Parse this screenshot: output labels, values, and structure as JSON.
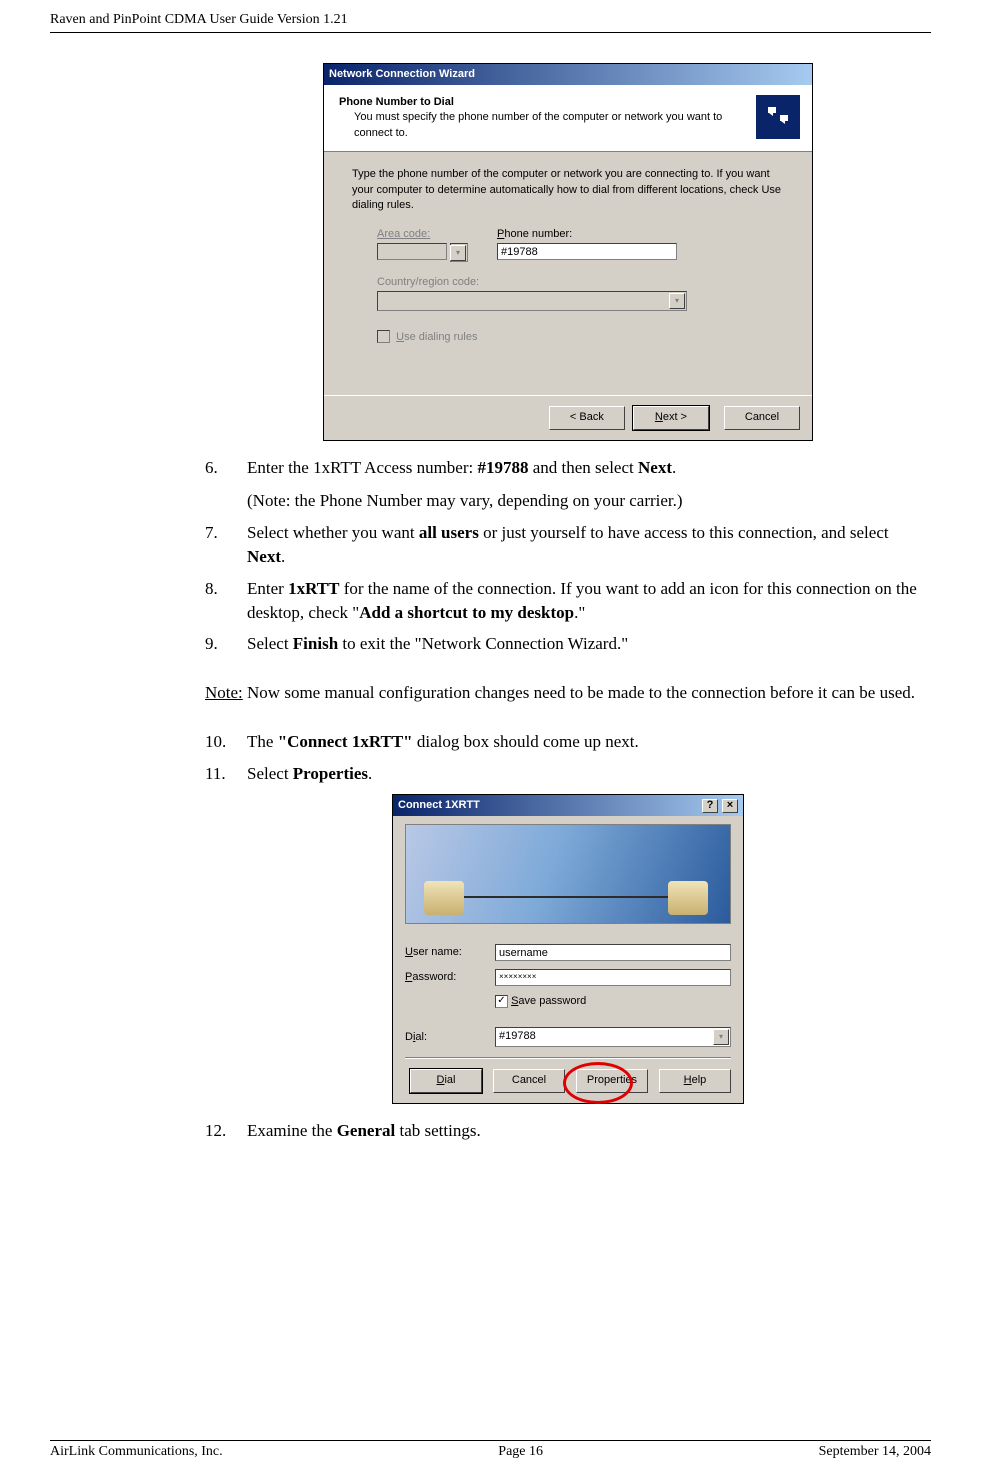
{
  "header": "Raven and PinPoint CDMA User Guide Version 1.21",
  "steps": {
    "s6_num": "6.",
    "s6": "Enter the 1xRTT Access number: ",
    "s6_b": "#19788",
    "s6_after": " and then select ",
    "s6_b2": "Next",
    "s6_end": ".",
    "s6_note": "(Note: the Phone Number may vary, depending on your carrier.)",
    "s7_num": "7.",
    "s7": "Select whether you want ",
    "s7_b": "all users",
    "s7_after": " or just yourself to have access to this connection, and select ",
    "s7_b2": "Next",
    "s7_end": ".",
    "s8_num": "8.",
    "s8": "Enter ",
    "s8_b": "1xRTT",
    "s8_after": " for the name of the connection. If you want to add an icon for this connection on the desktop, check \"",
    "s8_b2": "Add a shortcut to my desktop",
    "s8_end": ".\"",
    "s9_num": "9.",
    "s9": "Select ",
    "s9_b": "Finish",
    "s9_after": " to exit the \"Network Connection Wizard.\"",
    "note_lbl": "Note:",
    "note_txt": " Now some manual configuration changes need to be made to the connection before it can be used.",
    "s10_num": "10.",
    "s10": "The ",
    "s10_b": "\"Connect 1xRTT\"",
    "s10_after": " dialog box should come up next.",
    "s11_num": "11.",
    "s11": "Select ",
    "s11_b": "Properties",
    "s11_end": ".",
    "s12_num": "12.",
    "s12": "Examine the ",
    "s12_b": "General",
    "s12_after": " tab settings."
  },
  "dlg1": {
    "title": "Network Connection Wizard",
    "heading": "Phone Number to Dial",
    "sub": "You must specify the phone number of the computer or network you want to connect to.",
    "instr": "Type the phone number of the computer or network you are connecting to. If you want your computer to determine automatically how to dial from different locations, check Use dialing rules.",
    "lbl_area": "Area code:",
    "lbl_phone": "Phone number:",
    "phone_val": "#19788",
    "lbl_country": "Country/region code:",
    "chk_rules": "Use dialing rules",
    "btn_back": "< Back",
    "btn_next": "Next >",
    "btn_cancel": "Cancel"
  },
  "dlg2": {
    "title": "Connect 1XRTT",
    "help_icon": "?",
    "close_icon": "×",
    "lbl_user": "User name:",
    "user_val": "username",
    "lbl_pass": "Password:",
    "pass_val": "××××××××",
    "chk_save": "Save password",
    "lbl_dial": "Dial:",
    "dial_val": "#19788",
    "btn_dial": "Dial",
    "btn_cancel": "Cancel",
    "btn_props": "Properties",
    "btn_help": "Help"
  },
  "footer": {
    "left": "AirLink Communications, Inc.",
    "center": "Page 16",
    "right": "September 14, 2004"
  }
}
